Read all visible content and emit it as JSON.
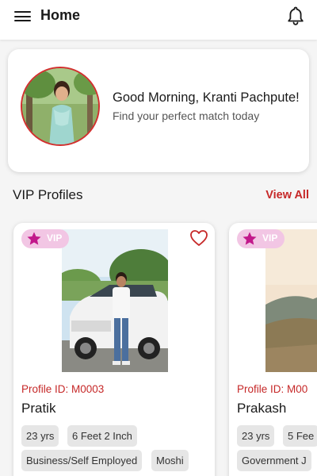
{
  "header": {
    "title": "Home",
    "menu_icon": "hamburger-menu-icon",
    "notification_icon": "bell-icon"
  },
  "greeting": {
    "title": "Good Morning, Kranti Pachpute!",
    "subtitle": "Find your perfect match today"
  },
  "vip_section": {
    "title": "VIP Profiles",
    "view_all": "View All",
    "badge_label": "VIP",
    "profiles": [
      {
        "profile_id": "Profile ID: M0003",
        "name": "Pratik",
        "age": "23 yrs",
        "height": "6 Feet 2 Inch",
        "occupation": "Business/Self Employed",
        "location": "Moshi"
      },
      {
        "profile_id": "Profile ID: M00",
        "name": "Prakash",
        "age": "23 yrs",
        "height": "5 Fee",
        "occupation": "Government J"
      }
    ]
  },
  "colors": {
    "accent_red": "#c62828",
    "vip_badge_bg": "#f2c6e4",
    "vip_star": "#c2188b",
    "chip_bg": "#e6e6e6"
  }
}
